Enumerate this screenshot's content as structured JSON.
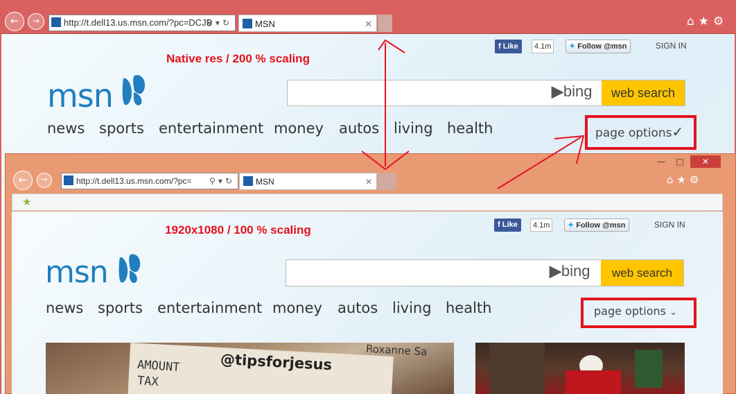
{
  "annotations": {
    "top_label": "Native res / 200 % scaling",
    "bottom_label": "1920x1080 / 100 % scaling"
  },
  "browser_top": {
    "address_url": "http://t.dell13.us.msn.com/?pc=DCJB",
    "tab_title": "MSN",
    "toolbar_icons": [
      "home-icon",
      "star-icon",
      "gear-icon"
    ]
  },
  "browser_bottom": {
    "address_url": "http://t.dell13.us.msn.com/?pc=",
    "tab_title": "MSN",
    "window_controls": [
      "minimize",
      "maximize",
      "close"
    ],
    "toolbar_icons": [
      "home-icon",
      "star-icon",
      "gear-icon"
    ]
  },
  "msn": {
    "logo_text": "msn",
    "facebook_like": "Like",
    "facebook_count": "4.1m",
    "twitter_follow": "Follow @msn",
    "sign_in": "SIGN IN",
    "search_placeholder": "",
    "bing_label": "bing",
    "web_search": "web search",
    "nav": [
      "news",
      "sports",
      "entertainment",
      "money",
      "autos",
      "living",
      "health"
    ],
    "page_options": "page options"
  },
  "tiles": {
    "receipt_lines": [
      "AMOUNT",
      "TAX",
      "@tipsforjesus",
      "Roxanne Sa"
    ]
  },
  "colors": {
    "top_chrome": "#d9605e",
    "bottom_chrome": "#ea9a73",
    "annotation_red": "#e5121d",
    "msn_blue": "#1f7fbf",
    "bing_yellow": "#ffc600"
  }
}
